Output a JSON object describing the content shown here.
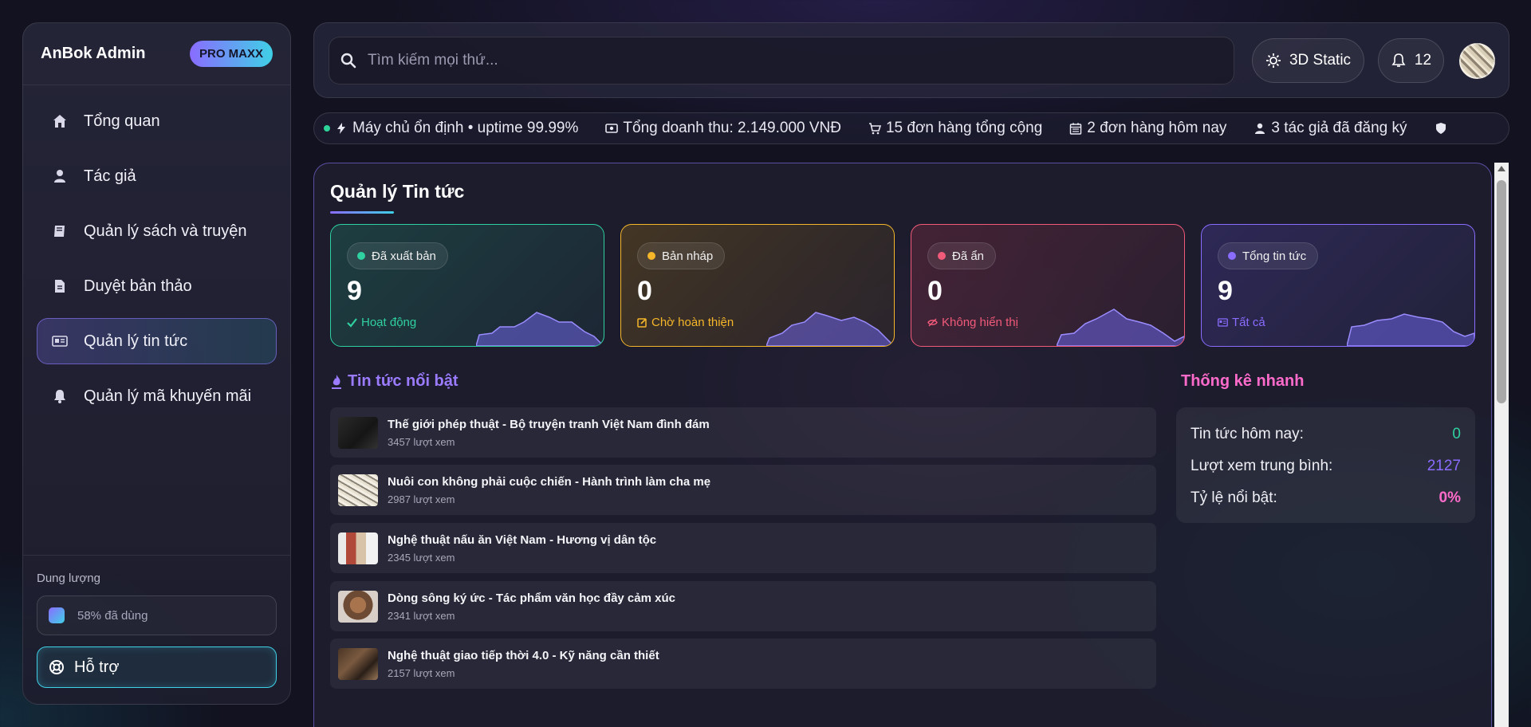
{
  "brand": "AnBok Admin",
  "badge": "PRO MAXX",
  "nav": [
    {
      "label": "Tổng quan",
      "icon": "home-icon"
    },
    {
      "label": "Tác giả",
      "icon": "user-icon"
    },
    {
      "label": "Quản lý sách và truyện",
      "icon": "book-icon"
    },
    {
      "label": "Duyệt bản thảo",
      "icon": "file-icon"
    },
    {
      "label": "Quản lý tin tức",
      "icon": "newspaper-icon",
      "active": true
    },
    {
      "label": "Quản lý mã khuyến mãi",
      "icon": "bell-icon"
    }
  ],
  "storage": {
    "label": "Dung lượng",
    "value": "58% đã dùng"
  },
  "support": "Hỗ trợ",
  "search": {
    "placeholder": "Tìm kiếm mọi thứ..."
  },
  "topbar": {
    "mode_label": "3D Static",
    "notifications": "12"
  },
  "ticker": [
    {
      "icon": "bolt-icon",
      "text": "Máy chủ ổn định • uptime 99.99%"
    },
    {
      "icon": "money-icon",
      "text": "Tổng doanh thu: 2.149.000 VNĐ"
    },
    {
      "icon": "cart-icon",
      "text": "15 đơn hàng tổng cộng"
    },
    {
      "icon": "calendar-icon",
      "text": "2 đơn hàng hôm nay"
    },
    {
      "icon": "user-icon",
      "text": "3 tác giả đã đăng ký"
    }
  ],
  "page_title": "Quản lý Tin tức",
  "cards": [
    {
      "label": "Đã xuất bản",
      "value": "9",
      "status": "Hoạt động",
      "color": "#2fd1a0"
    },
    {
      "label": "Bản nháp",
      "value": "0",
      "status": "Chờ hoàn thiện",
      "color": "#f5b62a"
    },
    {
      "label": "Đã ẩn",
      "value": "0",
      "status": "Không hiển thị",
      "color": "#f25a7a"
    },
    {
      "label": "Tổng tin tức",
      "value": "9",
      "status": "Tất cả",
      "color": "#8a6cff"
    }
  ],
  "featured_title": "Tin tức nổi bật",
  "featured": [
    {
      "title": "Thế giới phép thuật - Bộ truyện tranh Việt Nam đình đám",
      "views": "3457 lượt xem"
    },
    {
      "title": "Nuôi con không phải cuộc chiến - Hành trình làm cha mẹ",
      "views": "2987 lượt xem"
    },
    {
      "title": "Nghệ thuật nấu ăn Việt Nam - Hương vị dân tộc",
      "views": "2345 lượt xem"
    },
    {
      "title": "Dòng sông ký ức - Tác phẩm văn học đầy cảm xúc",
      "views": "2341 lượt xem"
    },
    {
      "title": "Nghệ thuật giao tiếp thời 4.0 - Kỹ năng cần thiết",
      "views": "2157 lượt xem"
    }
  ],
  "quick_stats_title": "Thống kê nhanh",
  "quick_stats": [
    {
      "label": "Tin tức hôm nay:",
      "value": "0"
    },
    {
      "label": "Lượt xem trung bình:",
      "value": "2127"
    },
    {
      "label": "Tỷ lệ nổi bật:",
      "value": "0%"
    }
  ]
}
